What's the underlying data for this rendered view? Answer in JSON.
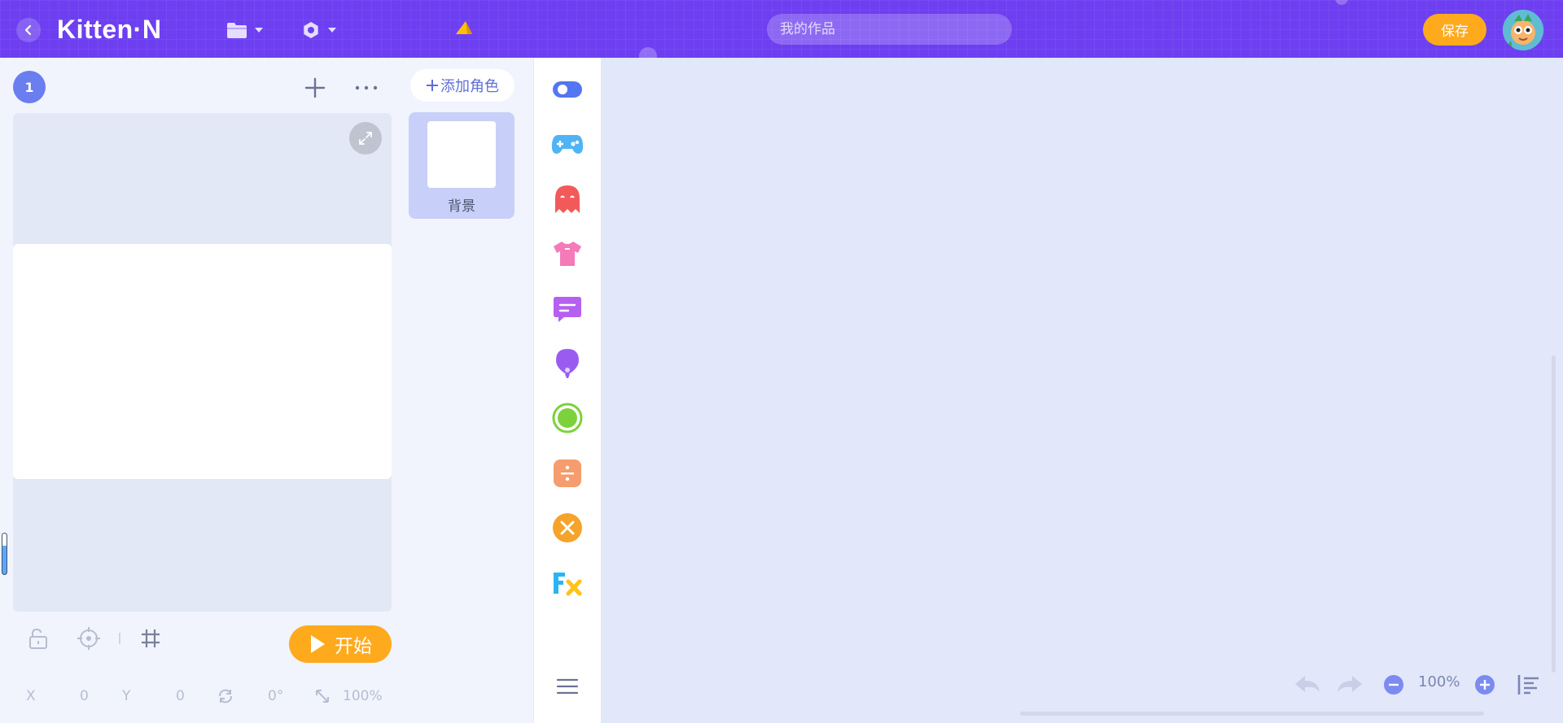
{
  "header": {
    "logo_text": "Kitten·N",
    "title_placeholder": "我的作品",
    "save_label": "保存"
  },
  "stage": {
    "scene_number": "1",
    "start_label": "开始",
    "coords": {
      "x_label": "X",
      "x_value": "0",
      "y_label": "Y",
      "y_value": "0",
      "rotation": "0°",
      "scale": "100%"
    }
  },
  "sprites": {
    "add_label": "添加角色",
    "items": [
      {
        "label": "背景"
      }
    ]
  },
  "categories": [
    {
      "icon": "toggle-icon",
      "color": "#5476f2"
    },
    {
      "icon": "gamepad-icon",
      "color": "#4fb4f5"
    },
    {
      "icon": "ghost-icon",
      "color": "#f25a5a"
    },
    {
      "icon": "shirt-icon",
      "color": "#f57ab8"
    },
    {
      "icon": "speech-bubble-icon",
      "color": "#b560f0"
    },
    {
      "icon": "balloon-icon",
      "color": "#9a5cf0"
    },
    {
      "icon": "circle-target-icon",
      "color": "#7dd13a"
    },
    {
      "icon": "divide-icon",
      "color": "#f59d6e"
    },
    {
      "icon": "multiply-icon",
      "color": "#f5a32a"
    },
    {
      "icon": "fx-icon",
      "color": "#2ab4f5"
    }
  ],
  "workspace": {
    "zoom_level": "100%"
  },
  "colors": {
    "header_bg": "#6d3ff0",
    "accent_orange": "#ffaa1d",
    "panel_bg": "#f1f4fd",
    "workspace_bg": "#e2e8fa"
  }
}
